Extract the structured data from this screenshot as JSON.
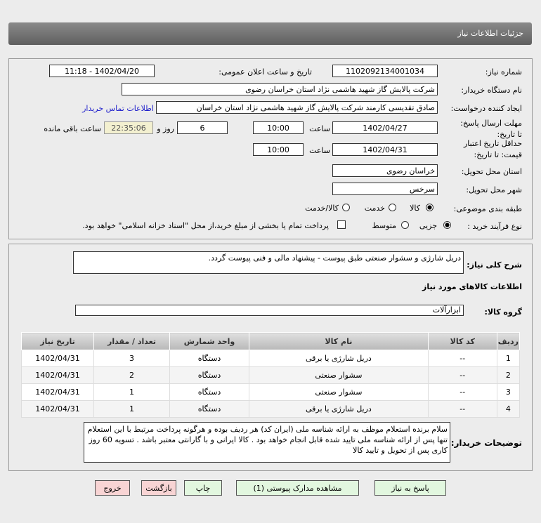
{
  "header": {
    "title": "جزئیات اطلاعات نیاز"
  },
  "form": {
    "need_number_label": "شماره نیاز:",
    "need_number": "1102092134001034",
    "announce_label": "تاریخ و ساعت اعلان عمومی:",
    "announce_value": "1402/04/20 - 11:18",
    "buyer_label": "نام دستگاه خریدار:",
    "buyer_value": "شرکت پالایش گاز شهید هاشمی نژاد   استان خراسان رضوی",
    "creator_label": "ایجاد کننده درخواست:",
    "creator_value": "صادق تقدیسی کارمند شرکت پالایش گاز شهید هاشمی نژاد   استان خراسان",
    "contact_link": "اطلاعات تماس خریدار",
    "deadline_label": "مهلت ارسال پاسخ: تا تاریخ:",
    "deadline_date": "1402/04/27",
    "time_label": "ساعت",
    "deadline_time": "10:00",
    "days": "6",
    "days_label": "روز و",
    "remaining": "22:35:06",
    "remaining_label": "ساعت باقی مانده",
    "validity_label": "حداقل تاریخ اعتبار قیمت: تا تاریخ:",
    "validity_date": "1402/04/31",
    "validity_time": "10:00",
    "province_label": "استان محل تحویل:",
    "province": "خراسان رضوی",
    "city_label": "شهر محل تحویل:",
    "city": "سرخس",
    "category_label": "طبقه بندی موضوعی:",
    "category_options": [
      "کالا",
      "خدمت",
      "کالا/خدمت"
    ],
    "category_selected": "کالا",
    "process_label": "نوع فرآیند خرید :",
    "process_options": [
      "جزیی",
      "متوسط"
    ],
    "process_selected": "جزیی",
    "payment_note": "پرداخت تمام یا بخشی از مبلغ خرید،از محل \"اسناد خزانه اسلامی\" خواهد بود."
  },
  "details": {
    "summary_label": "شرح کلی نیاز:",
    "summary": "دریل شارژی و سشوار صنعتی طبق پیوست - پیشنهاد مالی و فنی پیوست گردد.",
    "items_title": "اطلاعات کالاهای مورد نیاز",
    "group_label": "گروه کالا:",
    "group_value": "ابزارآلات",
    "columns": [
      "ردیف",
      "کد کالا",
      "نام کالا",
      "واحد شمارش",
      "تعداد / مقدار",
      "تاریخ نیاز"
    ],
    "rows": [
      [
        "1",
        "--",
        "دریل شارژی یا برقی",
        "دستگاه",
        "3",
        "1402/04/31"
      ],
      [
        "2",
        "--",
        "سشوار صنعتی",
        "دستگاه",
        "2",
        "1402/04/31"
      ],
      [
        "3",
        "--",
        "سشوار صنعتی",
        "دستگاه",
        "1",
        "1402/04/31"
      ],
      [
        "4",
        "--",
        "دریل شارژی یا برقی",
        "دستگاه",
        "1",
        "1402/04/31"
      ]
    ],
    "buyer_notes_label": "توضیحات خریدار:",
    "buyer_notes": "سلام  برنده استعلام موظف به ارائه شناسه ملی (ایران کد) هر ردیف بوده و هرگونه پرداخت مرتبط با این استعلام تنها پس از ارائه شناسه ملی تایید شده قابل انجام خواهد بود . کالا ایرانی و با گارانتی معتبر باشد . تسویه 60 روز کاری پس از تحویل و تایید کالا"
  },
  "buttons": {
    "reply": "پاسخ به نیاز",
    "attachments": "مشاهده مدارک پیوستی (1)",
    "print": "چاپ",
    "back": "بازگشت",
    "exit": "خروج"
  }
}
